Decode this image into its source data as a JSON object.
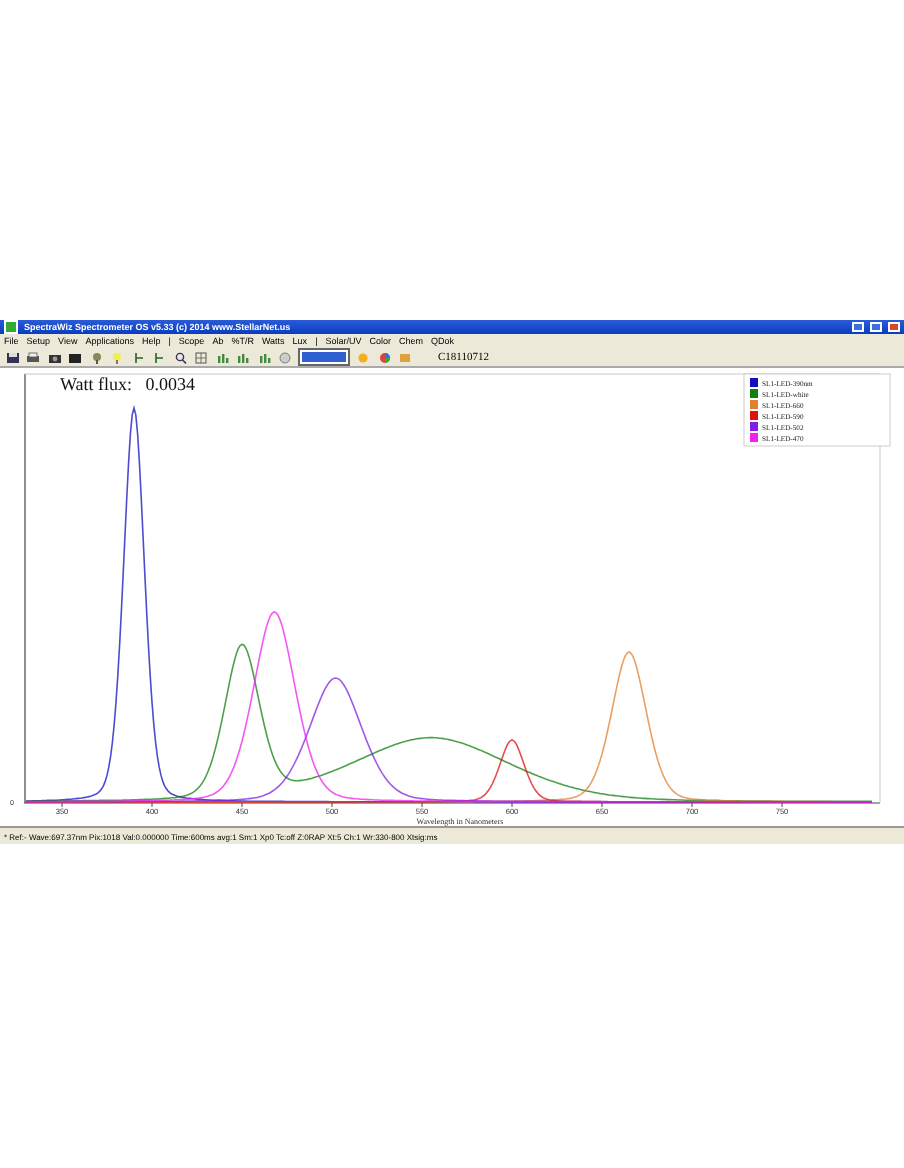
{
  "window": {
    "title": "SpectraWiz  Spectrometer OS v5.33 (c) 2014    www.StellarNet.us"
  },
  "menu": [
    "File",
    "Setup",
    "View",
    "Applications",
    "Help",
    "|",
    "Scope",
    "Ab",
    "%T/R",
    "Watts",
    "Lux",
    "|",
    "Solar/UV",
    "Color",
    "Chem",
    "QDok"
  ],
  "toolbar": {
    "serial": "C18110712"
  },
  "chart": {
    "readout": "Watt flux:   0.0034",
    "x_tick_labels": [
      "350",
      "400",
      "450",
      "500",
      "550",
      "600",
      "650",
      "700",
      "750"
    ],
    "y_tick_labels": [
      "0"
    ],
    "xlabel": "Wavelength in Nanometers",
    "legend": [
      {
        "label": "SL1-LED-390nm",
        "color": "#1010c0"
      },
      {
        "label": "SL1-LED-white",
        "color": "#108010"
      },
      {
        "label": "SL1-LED-660",
        "color": "#e08030"
      },
      {
        "label": "SL1-LED-590",
        "color": "#e01010"
      },
      {
        "label": "SL1-LED-502",
        "color": "#8020e0"
      },
      {
        "label": "SL1-LED-470",
        "color": "#f020f0"
      }
    ]
  },
  "status_bar": "* Ref:-   Wave:697.37nm  Pix:1018  Val:0.000000  Time:600ms  avg:1  Sm:1  Xp0  Tc:off  Z:0RAP  Xt:5  Ch:1  Wr:330-800  Xtsig:ms"
}
